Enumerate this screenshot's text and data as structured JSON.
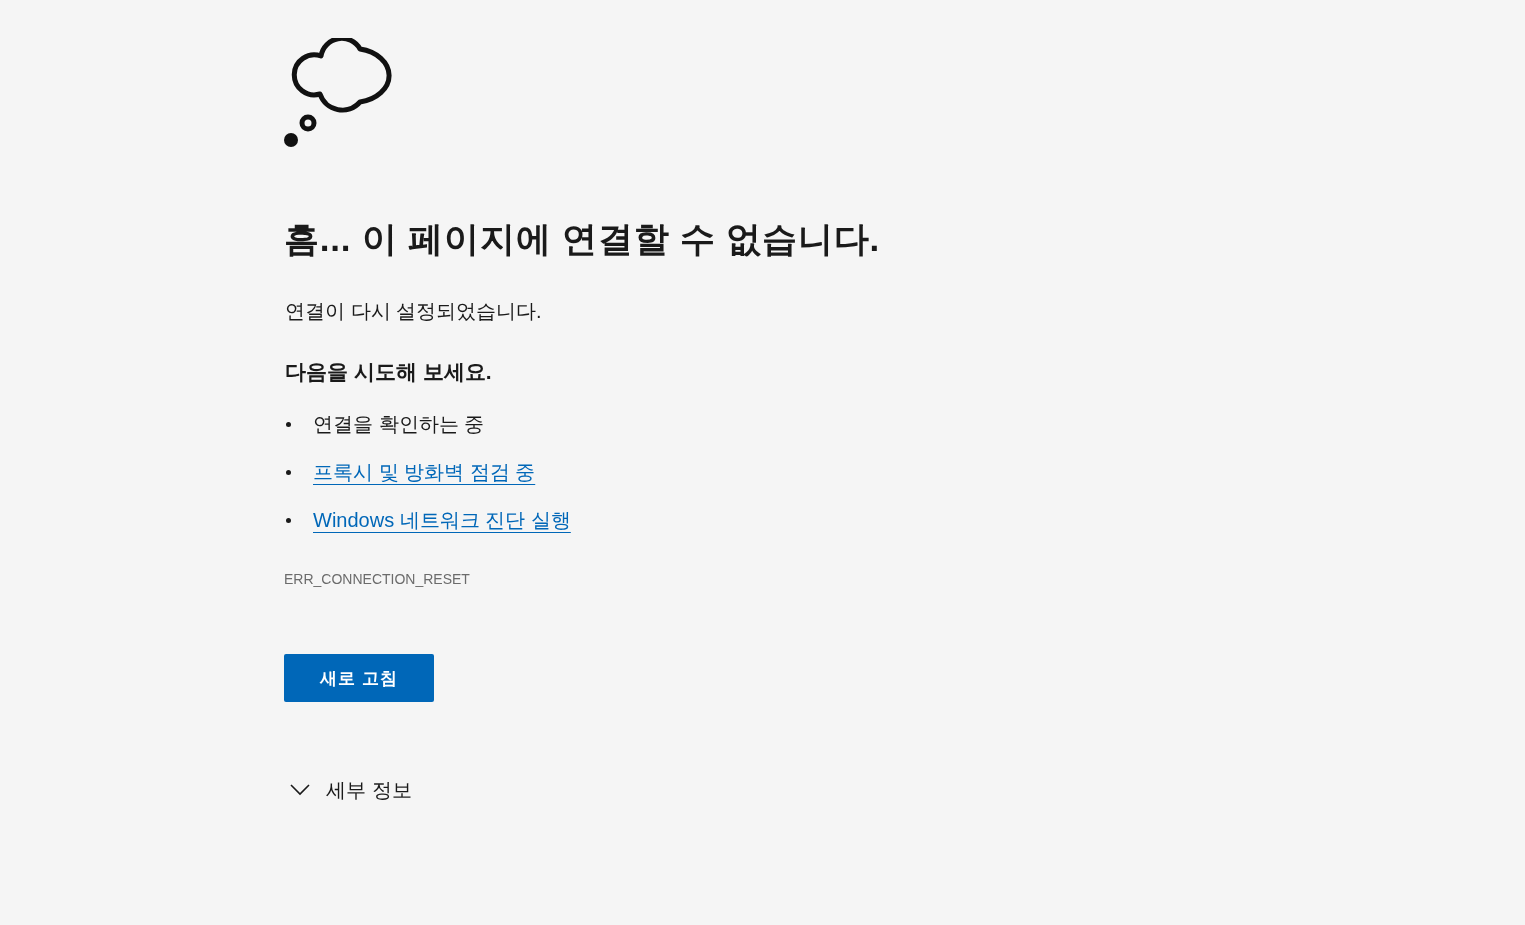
{
  "title": "흠... 이 페이지에 연결할 수 없습니다.",
  "message": "연결이 다시 설정되었습니다.",
  "suggestions": {
    "heading": "다음을 시도해 보세요.",
    "items": [
      {
        "kind": "text",
        "label": "연결을 확인하는 중"
      },
      {
        "kind": "link",
        "label": "프록시 및 방화벽 점검 중"
      },
      {
        "kind": "link",
        "label": "Windows 네트워크 진단 실행"
      }
    ]
  },
  "error_code": "ERR_CONNECTION_RESET",
  "reload_button": {
    "label": "새로 고침"
  },
  "details": {
    "label": "세부 정보",
    "expanded": false
  }
}
